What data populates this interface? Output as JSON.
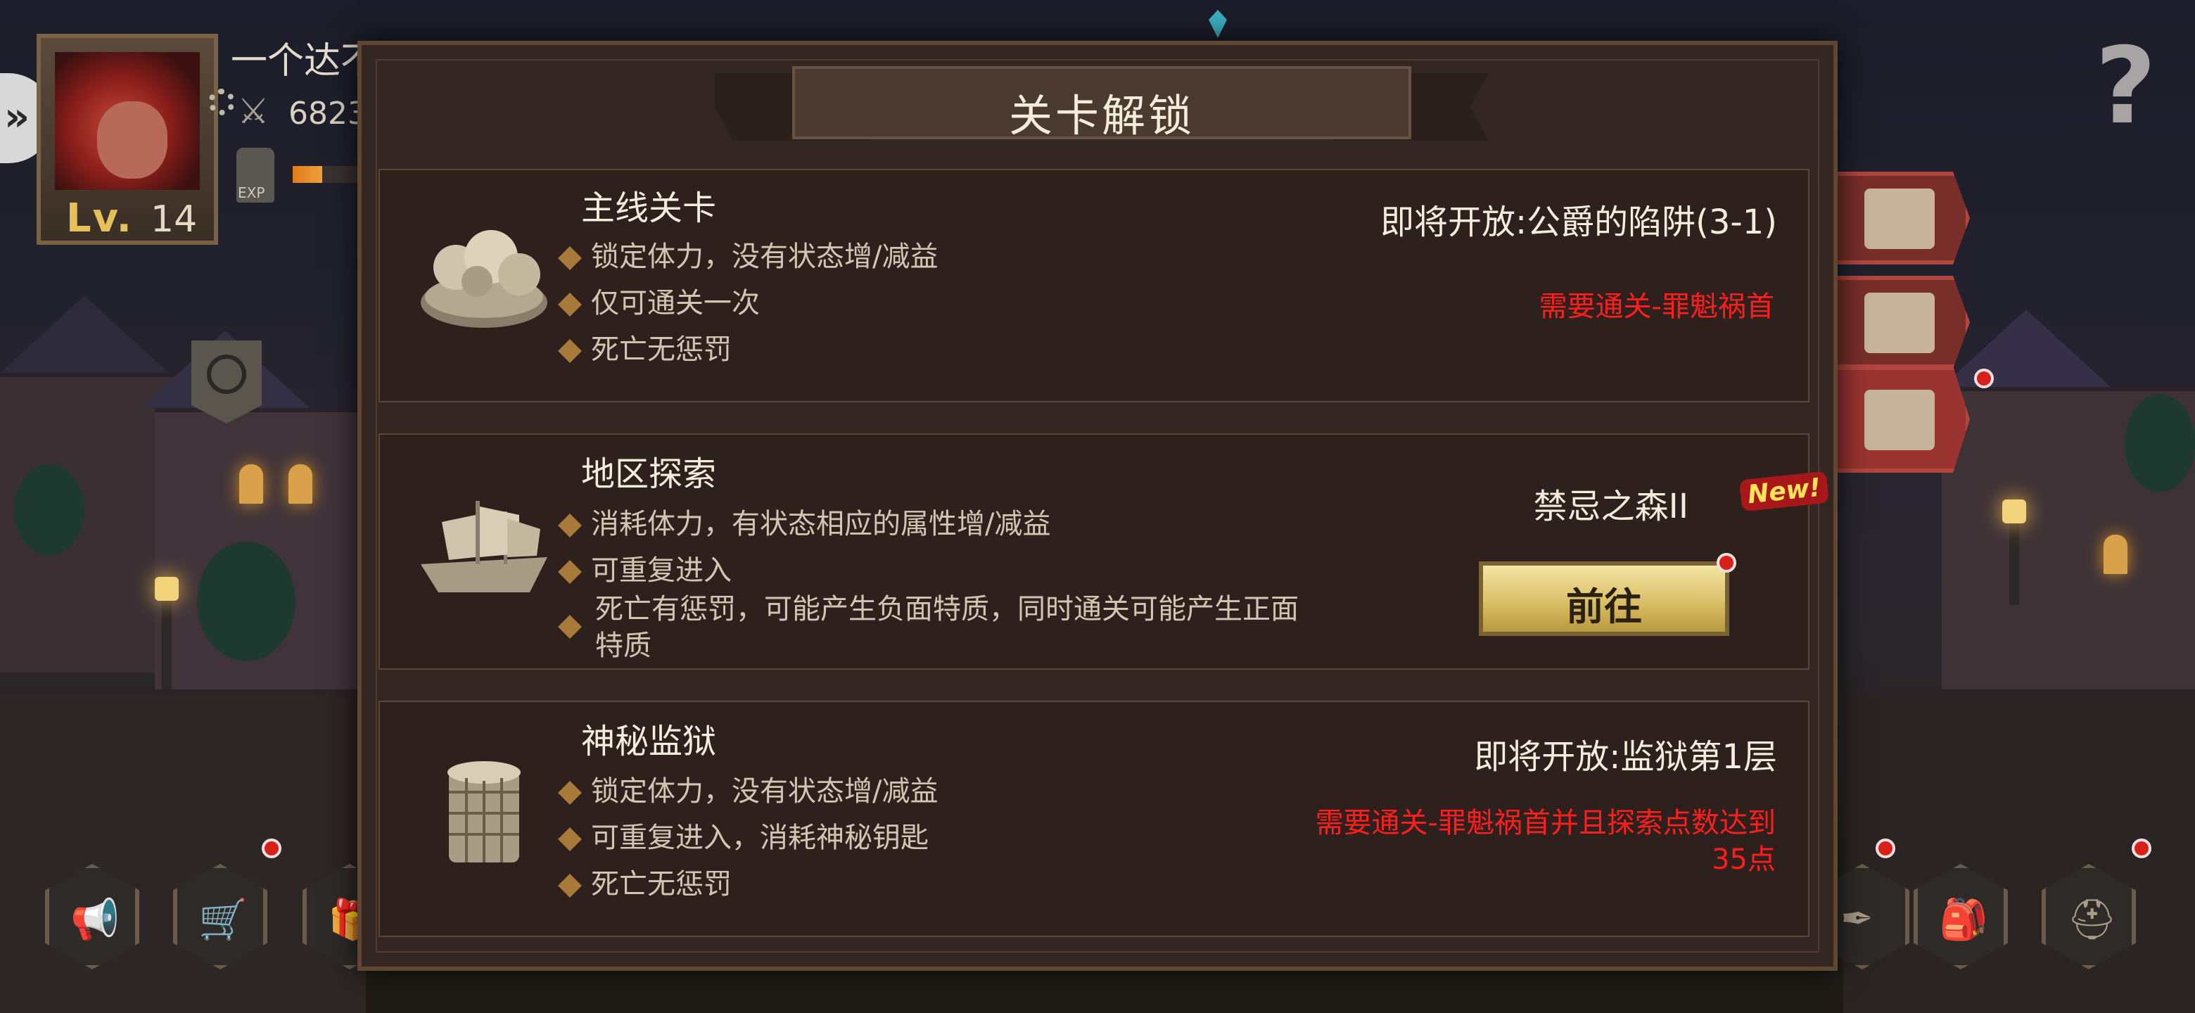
{
  "player": {
    "name": "一个达不溜",
    "power": "6823",
    "level_prefix": "Lv.",
    "level": "14",
    "exp_label": "EXP",
    "exp_progress": 0.35
  },
  "dialog": {
    "title": "关卡解锁",
    "sections": [
      {
        "title": "主线关卡",
        "icon": "forest-island-icon",
        "bullets": [
          "锁定体力，没有状态增/减益",
          "仅可通关一次",
          "死亡无惩罚"
        ],
        "status": "即将开放:公爵的陷阱(3-1)",
        "requirement": "需要通关-罪魁祸首"
      },
      {
        "title": "地区探索",
        "icon": "sailing-ship-icon",
        "bullets": [
          "消耗体力，有状态相应的属性增/减益",
          "可重复进入",
          "死亡有惩罚，可能产生负面特质，同时通关可能产生正面特质"
        ],
        "status": "禁忌之森II",
        "badge": "New!",
        "button": "前往"
      },
      {
        "title": "神秘监狱",
        "icon": "prison-tower-icon",
        "bullets": [
          "锁定体力，没有状态增/减益",
          "可重复进入，消耗神秘钥匙",
          "死亡无惩罚"
        ],
        "status": "即将开放:监狱第1层",
        "requirement": "需要通关-罪魁祸首并且探索点数达到35点"
      }
    ]
  },
  "help_label": "?",
  "colors": {
    "requirement_red": "#ff1e1e",
    "button_gold": "#d8bc62",
    "tab_red": "#7a2e2a",
    "panel_bg": "#2e211d"
  }
}
